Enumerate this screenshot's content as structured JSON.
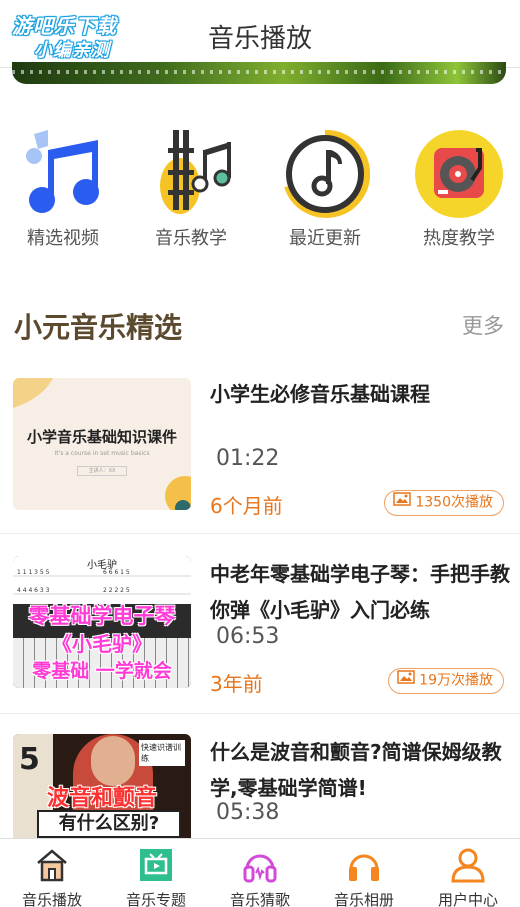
{
  "header": {
    "logo_line1": "游吧乐下载",
    "logo_line2": "小编亲测",
    "title": "音乐播放"
  },
  "categories": [
    {
      "label": "精选视频",
      "icon": "music-note-icon"
    },
    {
      "label": "音乐教学",
      "icon": "guitar-notes-icon"
    },
    {
      "label": "最近更新",
      "icon": "music-circle-icon"
    },
    {
      "label": "热度教学",
      "icon": "record-player-icon"
    }
  ],
  "section": {
    "title": "小元音乐精选",
    "more": "更多"
  },
  "items": [
    {
      "title": "小学生必修音乐基础课程",
      "duration": "01:22",
      "age": "6个月前",
      "plays": "1350次播放",
      "thumb_text": "小学音乐基础知识课件",
      "thumb_sub": "It's a course in set music basics",
      "thumb_btn": "主讲人：XX"
    },
    {
      "title": "中老年零基础学电子琴：手把手教你弹《小毛驴》入门必练",
      "duration": "06:53",
      "age": "3年前",
      "plays": "19万次播放",
      "thumb_top": "小毛驴",
      "thumb_line1": "零基础学电子琴",
      "thumb_line2": "《小毛驴》",
      "thumb_line3": "零基础 一学就会"
    },
    {
      "title": "什么是波音和颤音?简谱保姆级教学,零基础学简谱!",
      "duration": "05:38",
      "thumb_line1": "波音和颤音",
      "thumb_line2": "有什么区别?",
      "thumb_tag": "快速识谱训练"
    }
  ],
  "nav": [
    {
      "label": "音乐播放",
      "icon": "home-icon"
    },
    {
      "label": "音乐专题",
      "icon": "tv-icon"
    },
    {
      "label": "音乐猜歌",
      "icon": "headphones-icon"
    },
    {
      "label": "音乐相册",
      "icon": "headphones-icon"
    },
    {
      "label": "用户中心",
      "icon": "user-icon"
    }
  ],
  "colors": {
    "accent": "#e8751a",
    "section_title": "#5b4a2e",
    "note_blue": "#2b5cf0",
    "yellow": "#f6c324"
  }
}
